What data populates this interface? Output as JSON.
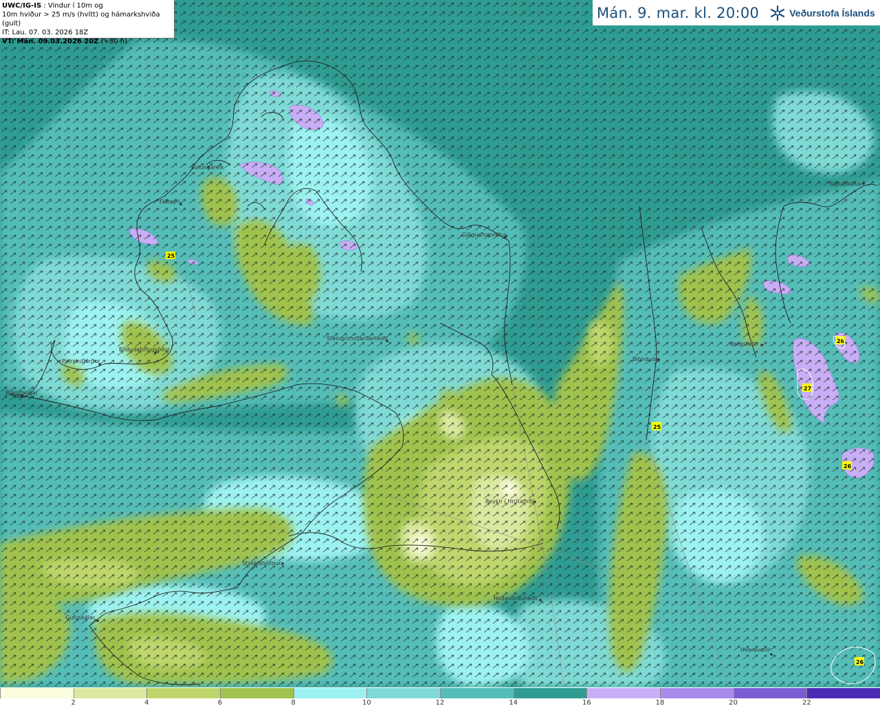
{
  "header": {
    "model": "UWC/IG-IS",
    "line1_rest": " : Vindur í 10m og",
    "line2": "10m hviður > 25 m/s (hvítt) og hámarkshviða (gult)",
    "line3": "IT: Lau. 07. 03. 2026 18Z",
    "line4_bold": "VT: Mán. 09.03.2026 20Z",
    "line4_rest": " (+50 h)"
  },
  "title": "Mán. 9. mar. kl. 20:00",
  "logo": {
    "icon": "vedurstofa-logo-icon",
    "text": "Veðurstofa Íslands"
  },
  "places": [
    "Bolungarvík",
    "Flateyri",
    "Patreksfjörður",
    "Bjargtangar",
    "Bíldudalsflugvöllur",
    "Gjögurflugvöllur",
    "Steingrímsfjarðarheiði",
    "Siglufjörður",
    "Bergstaðir",
    "Blönduós",
    "Reykir í Hrútafirði",
    "Stykkishólmur",
    "Holtavörðuheiði",
    "Gufuskálar",
    "Hveravellir"
  ],
  "gust_labels": [
    "25",
    "25",
    "26",
    "27",
    "26",
    "26"
  ],
  "legend": {
    "colors": [
      "#fafcdd",
      "#dbe9a0",
      "#bed66c",
      "#a0c24e",
      "#9cf2f0",
      "#7fdad6",
      "#54bdb8",
      "#2f9c92",
      "#c8aef5",
      "#a88ae9",
      "#7a5cd4",
      "#4b2cb6"
    ],
    "labels": [
      "2",
      "4",
      "6",
      "8",
      "10",
      "12",
      "14",
      "16",
      "18",
      "20",
      "22"
    ]
  }
}
